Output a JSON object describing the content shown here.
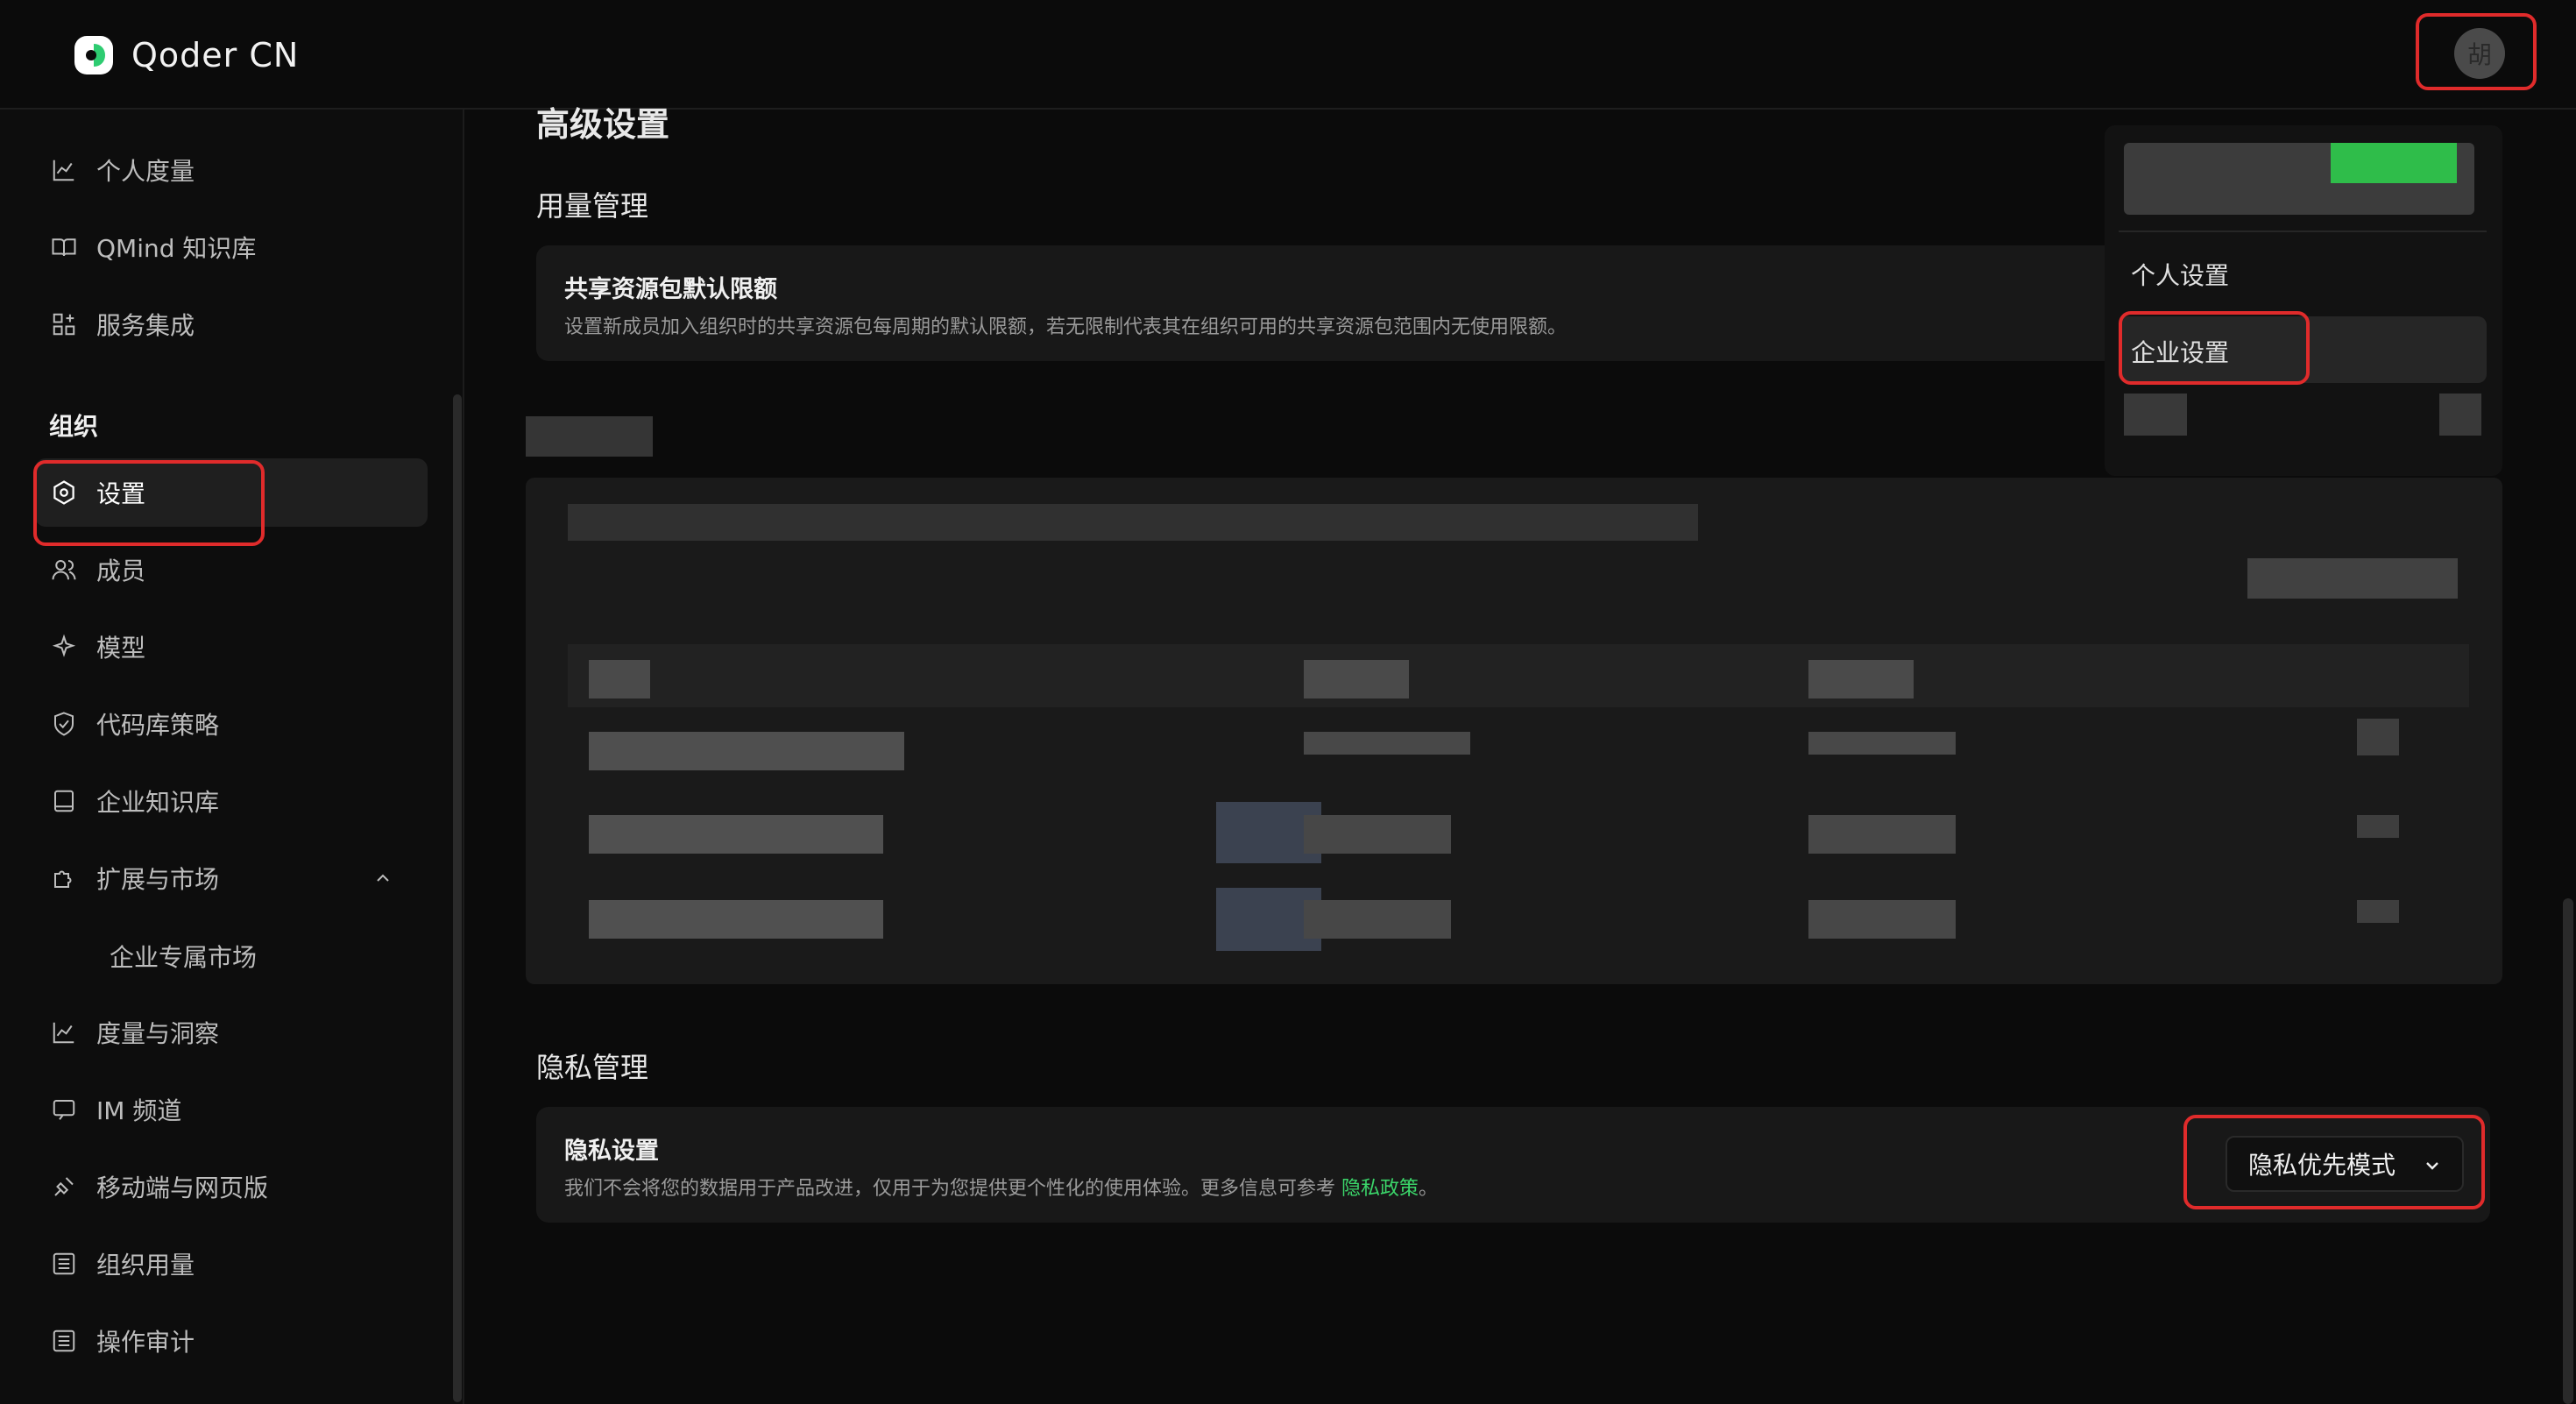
{
  "brand": {
    "name": "Qoder CN"
  },
  "user": {
    "avatar_initial": "胡"
  },
  "sidebar": {
    "items_top": [
      {
        "label": "个人度量",
        "icon": "line-chart-icon"
      },
      {
        "label": "QMind 知识库",
        "icon": "book-open-icon"
      },
      {
        "label": "服务集成",
        "icon": "grid-plus-icon"
      }
    ],
    "section_label": "组织",
    "items_org": [
      {
        "label": "设置",
        "icon": "settings-icon",
        "active": true
      },
      {
        "label": "成员",
        "icon": "users-icon"
      },
      {
        "label": "模型",
        "icon": "sparkle-icon"
      },
      {
        "label": "代码库策略",
        "icon": "shield-icon"
      },
      {
        "label": "企业知识库",
        "icon": "book-icon"
      },
      {
        "label": "扩展与市场",
        "icon": "puzzle-icon",
        "expanded": true
      },
      {
        "label": "企业专属市场",
        "sub": true
      },
      {
        "label": "度量与洞察",
        "icon": "line-chart-icon"
      },
      {
        "label": "IM 频道",
        "icon": "chat-icon"
      },
      {
        "label": "移动端与网页版",
        "icon": "plug-icon"
      },
      {
        "label": "组织用量",
        "icon": "list-icon"
      },
      {
        "label": "操作审计",
        "icon": "list-icon"
      }
    ]
  },
  "main": {
    "page_title": "高级设置",
    "usage_group_title": "用量管理",
    "shared_quota": {
      "title": "共享资源包默认限额",
      "desc": "设置新成员加入组织时的共享资源包每周期的默认限额，若无限制代表其在组织可用的共享资源包范围内无使用限额。"
    },
    "privacy_group_title": "隐私管理",
    "privacy": {
      "title": "隐私设置",
      "desc": "我们不会将您的数据用于产品改进，仅用于为您提供更个性化的使用体验。更多信息可参考 ",
      "link": "隐私政策",
      "desc_end": "。",
      "select_value": "隐私优先模式"
    }
  },
  "dropdown": {
    "items": [
      {
        "label": "个人设置"
      },
      {
        "label": "企业设置",
        "highlighted": true
      }
    ]
  },
  "colors": {
    "accent": "#3bd66a",
    "highlight_box": "#e02b2b"
  }
}
